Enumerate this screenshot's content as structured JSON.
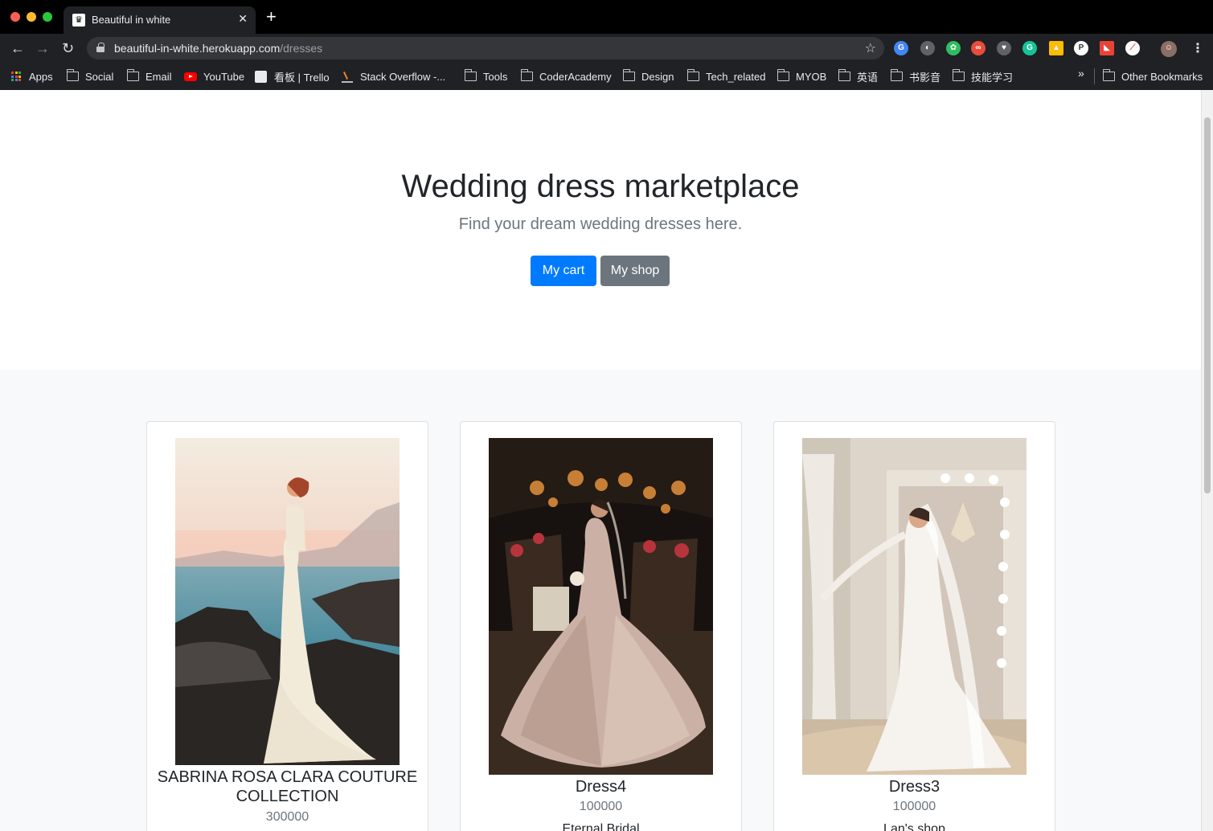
{
  "browser": {
    "tab_title": "Beautiful in white",
    "url_host": "beautiful-in-white.herokuapp.com",
    "url_path": "/dresses",
    "bookmarks": [
      {
        "label": "Apps",
        "icon": "apps-grid-icon"
      },
      {
        "label": "Social",
        "icon": "folder-icon"
      },
      {
        "label": "Email",
        "icon": "folder-icon"
      },
      {
        "label": "YouTube",
        "icon": "youtube-icon"
      },
      {
        "label": "看板 | Trello",
        "icon": "trello-icon"
      },
      {
        "label": "Stack Overflow -...",
        "icon": "stackoverflow-icon"
      },
      {
        "label": "Tools",
        "icon": "folder-icon"
      },
      {
        "label": "CoderAcademy",
        "icon": "folder-icon"
      },
      {
        "label": "Design",
        "icon": "folder-icon"
      },
      {
        "label": "Tech_related",
        "icon": "folder-icon"
      },
      {
        "label": "MYOB",
        "icon": "folder-icon"
      },
      {
        "label": "英语",
        "icon": "folder-icon"
      },
      {
        "label": "书影音",
        "icon": "folder-icon"
      },
      {
        "label": "技能学习",
        "icon": "folder-icon"
      }
    ],
    "other_bookmarks": "Other Bookmarks",
    "overflow_chevron": "»"
  },
  "hero": {
    "title": "Wedding dress marketplace",
    "subtitle": "Find your dream wedding dresses here.",
    "cart_button": "My cart",
    "shop_button": "My shop"
  },
  "dresses": [
    {
      "name": "SABRINA ROSA CLARA COUTURE COLLECTION",
      "price": "300000",
      "shop": ""
    },
    {
      "name": "Dress4",
      "price": "100000",
      "shop": "Eternal Bridal"
    },
    {
      "name": "Dress3",
      "price": "100000",
      "shop": "Lan's shop"
    }
  ],
  "colors": {
    "primary": "#007bff",
    "secondary": "#6c757d",
    "page_bg": "#f8f9fa"
  }
}
